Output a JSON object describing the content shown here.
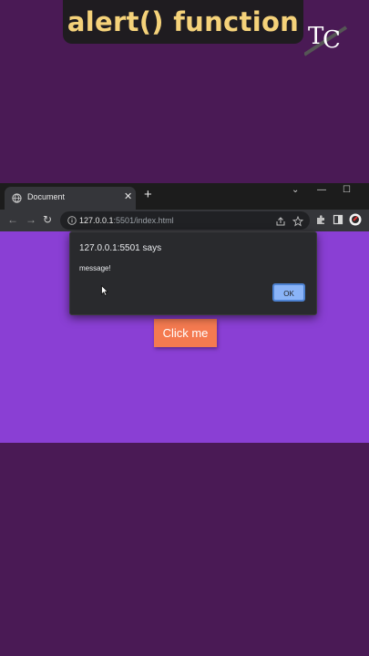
{
  "banner": {
    "title": "alert() function"
  },
  "logo": {
    "letters": "TC"
  },
  "browser": {
    "tab": {
      "title": "Document",
      "close": "✕"
    },
    "new_tab": "+",
    "window": {
      "chevron": "⌄",
      "minimize": "—",
      "maximize": "☐"
    },
    "url": {
      "host": "127.0.0.1",
      "rest": ":5501/index.html"
    }
  },
  "page": {
    "button_label": "Click me"
  },
  "alert": {
    "title": "127.0.0.1:5501 says",
    "message": "message!",
    "ok_label": "OK"
  },
  "colors": {
    "background": "#4a1a55",
    "viewport": "#8a3fd4",
    "button": "#f47a50",
    "banner_text": "#f5d27a",
    "ok_button": "#8ab4f8"
  }
}
